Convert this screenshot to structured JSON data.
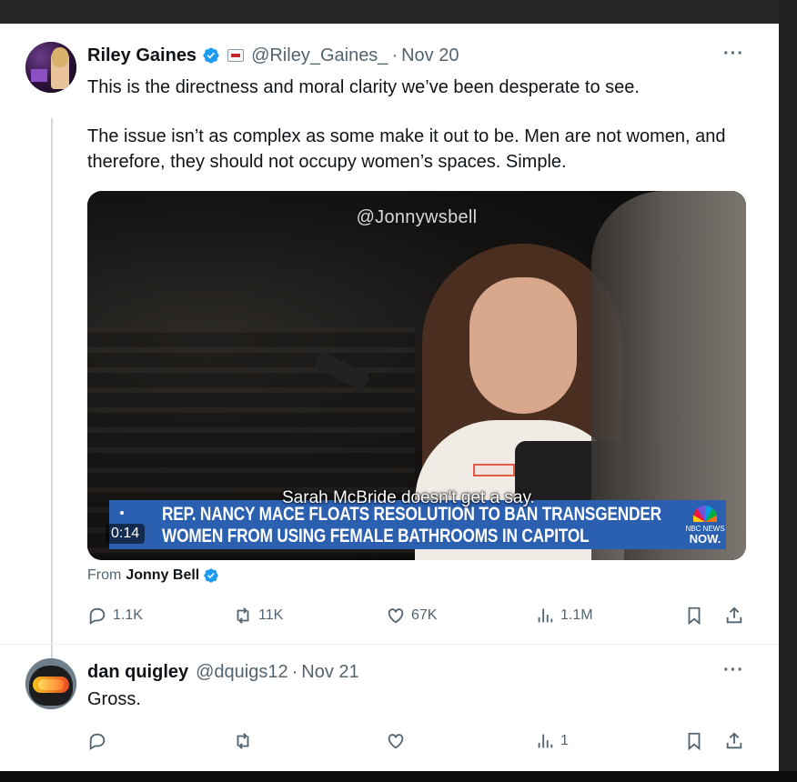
{
  "tweet": {
    "author": {
      "name": "Riley Gaines",
      "handle": "@Riley_Gaines_",
      "separator": "·",
      "date": "Nov 20"
    },
    "text": [
      "This is the directness and moral clarity we’ve been desperate to see.",
      "The issue isn’t as complex as some make it out to be. Men are not women, and therefore, they should not occupy women’s spaces. Simple."
    ],
    "more_label": "···",
    "media": {
      "watermark": "@Jonnywsbell",
      "caption": "Sarah McBride doesn't get a say.",
      "lower_third": [
        "REP. NANCY MACE FLOATS RESOLUTION TO BAN TRANSGENDER",
        "WOMEN FROM USING FEMALE BATHROOMS IN CAPITOL"
      ],
      "network_small": "NBC NEWS",
      "network_big": "NOW.",
      "duration": "0:14"
    },
    "from": {
      "prefix": "From",
      "name": "Jonny Bell"
    },
    "actions": {
      "replies": "1.1K",
      "reposts": "11K",
      "likes": "67K",
      "views": "1.1M"
    }
  },
  "reply": {
    "author": {
      "name": "dan quigley",
      "handle": "@dquigs12",
      "separator": "·",
      "date": "Nov 21"
    },
    "text": "Gross.",
    "more_label": "···",
    "actions": {
      "replies": "",
      "reposts": "",
      "likes": "",
      "views": "1"
    }
  },
  "colors": {
    "accent": "#1d9bf0",
    "muted": "#536471",
    "text": "#0f1419",
    "banner": "#2b5fb0"
  },
  "icons": [
    "verified-badge-icon",
    "affiliate-badge-icon",
    "reply-icon",
    "repost-icon",
    "like-icon",
    "views-icon",
    "bookmark-icon",
    "share-icon"
  ]
}
